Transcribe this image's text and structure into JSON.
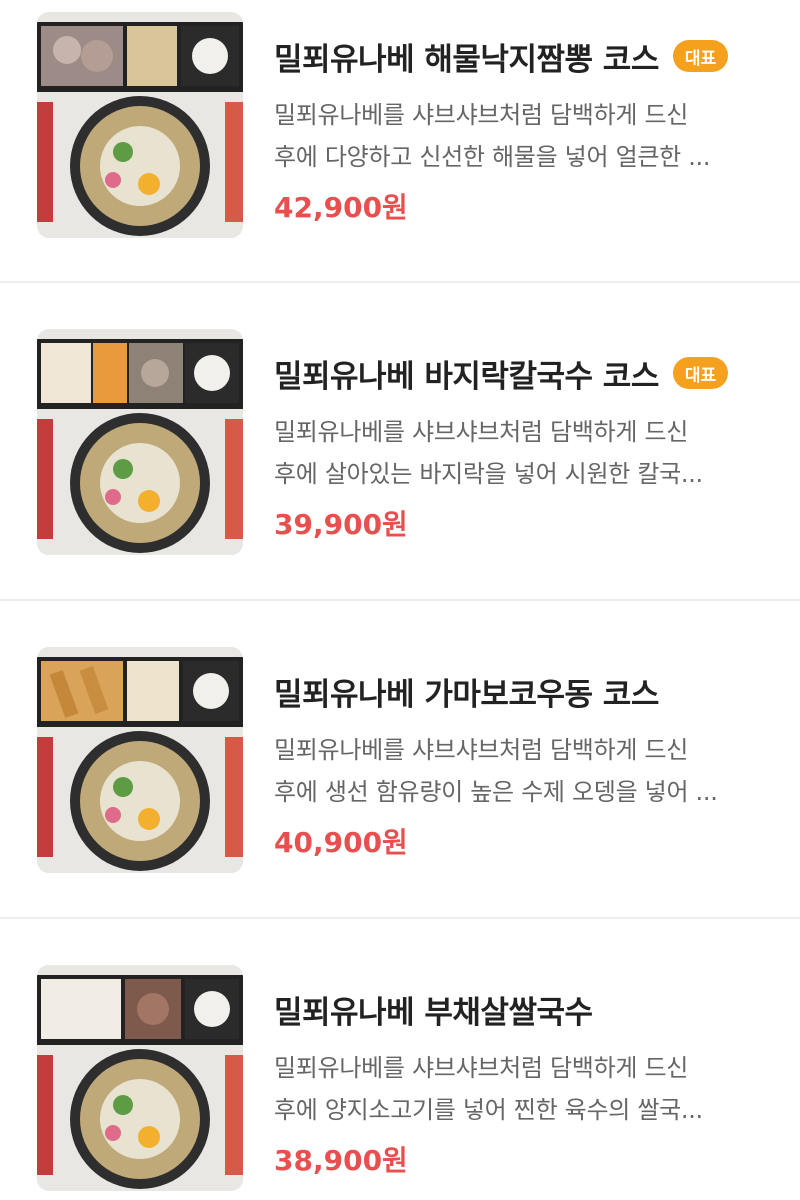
{
  "menu": [
    {
      "title": "밀푀유나베 해물낙지짬뽕 코스",
      "badge": "대표",
      "desc_line1": "밀푀유나베를 샤브샤브처럼 담백하게 드신",
      "desc_line2": "후에 다양하고 신선한 해물을 넣어 얼큰한 ...",
      "price": "42,900원",
      "image_alt": "seafood-set-photo"
    },
    {
      "title": "밀푀유나베 바지락칼국수 코스",
      "badge": "대표",
      "desc_line1": "밀푀유나베를 샤브샤브처럼 담백하게 드신",
      "desc_line2": "후에 살아있는 바지락을 넣어 시원한 칼국...",
      "price": "39,900원",
      "image_alt": "clam-noodle-set-photo"
    },
    {
      "title": "밀푀유나베 가마보코우동 코스",
      "badge": "",
      "desc_line1": "밀푀유나베를 샤브샤브처럼 담백하게 드신",
      "desc_line2": "후에 생선 함유량이 높은 수제 오뎅을 넣어 ...",
      "price": "40,900원",
      "image_alt": "fishcake-udon-set-photo"
    },
    {
      "title": "밀푀유나베 부채살쌀국수",
      "badge": "",
      "desc_line1": "밀푀유나베를 샤브샤브처럼 담백하게 드신",
      "desc_line2": "후에 양지소고기를 넣어 찐한 육수의 쌀국...",
      "price": "38,900원",
      "image_alt": "beef-rice-noodle-set-photo"
    }
  ],
  "colors": {
    "price": "#ea4f4f",
    "badge": "#f6a11d",
    "divider": "#eeeeee"
  }
}
